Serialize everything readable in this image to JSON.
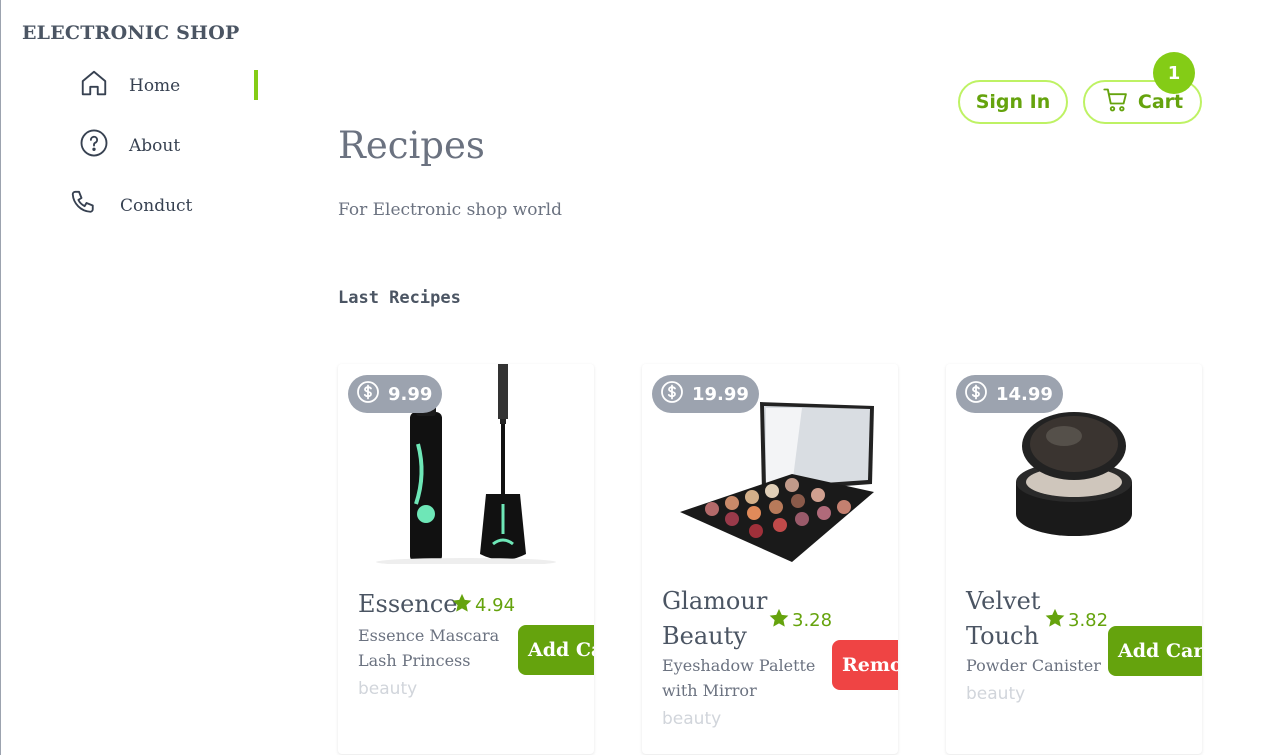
{
  "brand": {
    "name": "ELECTRONIC SHOP"
  },
  "nav": {
    "items": [
      {
        "label": "Home",
        "icon": "home-icon",
        "active": true
      },
      {
        "label": "About",
        "icon": "question-circle-icon",
        "active": false
      },
      {
        "label": "Conduct",
        "icon": "phone-icon",
        "active": false
      }
    ]
  },
  "header": {
    "sign_in_label": "Sign In",
    "cart_label": "Cart",
    "cart_count": "1"
  },
  "main": {
    "title": "Recipes",
    "subtitle": "For Electronic shop world",
    "section_title": "Last Recipes"
  },
  "products": [
    {
      "price": "9.99",
      "name": "Essence",
      "rating": "4.94",
      "description": "Essence Mascara Lash Princess",
      "category": "beauty",
      "action": "Add Cart",
      "image": "mascara"
    },
    {
      "price": "19.99",
      "name": "Glamour Beauty",
      "rating": "3.28",
      "description": "Eyeshadow Palette with Mirror",
      "category": "beauty",
      "action": "Remove",
      "image": "eyeshadow-palette"
    },
    {
      "price": "14.99",
      "name": "Velvet Touch",
      "rating": "3.82",
      "description": "Powder Canister",
      "category": "beauty",
      "action": "Add Cart",
      "image": "powder-compact"
    }
  ],
  "colors": {
    "accent": "#84cc16",
    "accent_dark": "#65a30d",
    "danger": "#ef4444",
    "price_badge": "#9ca3af"
  }
}
